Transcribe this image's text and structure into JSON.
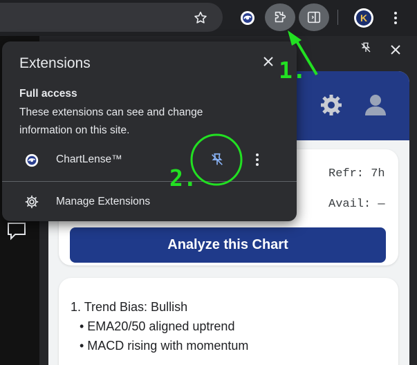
{
  "toolbar": {
    "icons": [
      "star-icon",
      "chartlense-icon",
      "extensions-puzzle-icon",
      "side-panel-icon",
      "profile-avatar-icon",
      "menu-dots-icon"
    ]
  },
  "side_panel": {
    "icons": [
      "unpin-icon",
      "close-icon"
    ]
  },
  "app": {
    "refresh_label": "Refr: 7h",
    "avail_label": "Avail: —",
    "analyze_button": "Analyze this Chart",
    "result": {
      "heading": "1. Trend Bias: Bullish",
      "bullets": [
        "• EMA20/50 aligned uptrend",
        "• MACD rising with momentum"
      ]
    },
    "header_icons": [
      "gear-icon",
      "user-icon"
    ],
    "header_color": "#223a86",
    "button_color": "#1f3a8a"
  },
  "extensions_popup": {
    "title": "Extensions",
    "section_title": "Full access",
    "description_line1": "These extensions can see and change",
    "description_line2": "information on this site.",
    "extension_name": "ChartLense™",
    "manage_label": "Manage Extensions"
  },
  "annotations": {
    "step1": "1.",
    "step2": "2.",
    "color": "#22e022"
  }
}
